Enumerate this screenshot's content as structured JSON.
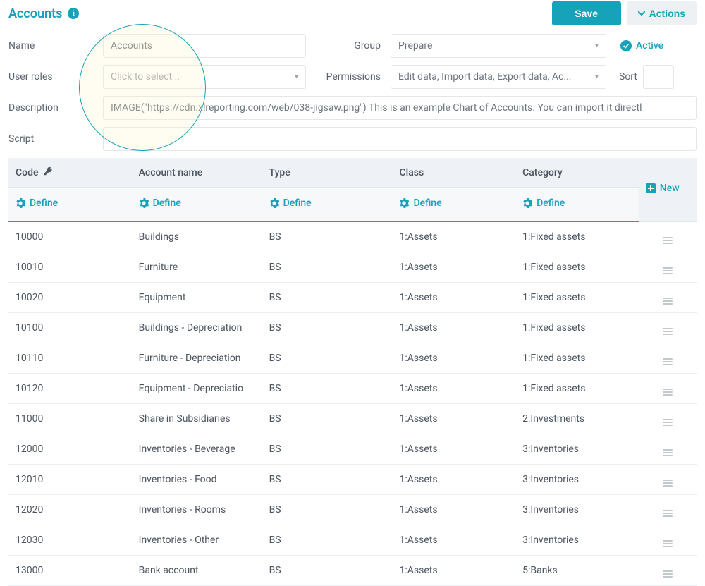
{
  "header": {
    "title": "Accounts",
    "save_label": "Save",
    "actions_label": "Actions"
  },
  "form": {
    "name_label": "Name",
    "name_value": "Accounts",
    "group_label": "Group",
    "group_value": "Prepare",
    "active_label": "Active",
    "userroles_label": "User roles",
    "userroles_placeholder": "Click to select ..",
    "permissions_label": "Permissions",
    "permissions_value": "Edit data, Import data, Export data, Ac...",
    "sort_label": "Sort",
    "sort_value": "",
    "description_label": "Description",
    "description_value": "IMAGE(\"https://cdn.xlreporting.com/web/038-jigsaw.png\") This is an example Chart of Accounts. You can import it directl",
    "script_label": "Script",
    "script_value": ""
  },
  "table": {
    "columns": {
      "code": "Code",
      "account_name": "Account name",
      "type": "Type",
      "class": "Class",
      "category": "Category"
    },
    "define_label": "Define",
    "new_label": "New",
    "rows": [
      {
        "code": "10000",
        "name": "Buildings",
        "type": "BS",
        "class": "1:Assets",
        "category": "1:Fixed assets"
      },
      {
        "code": "10010",
        "name": "Furniture",
        "type": "BS",
        "class": "1:Assets",
        "category": "1:Fixed assets"
      },
      {
        "code": "10020",
        "name": "Equipment",
        "type": "BS",
        "class": "1:Assets",
        "category": "1:Fixed assets"
      },
      {
        "code": "10100",
        "name": "Buildings - Depreciation",
        "type": "BS",
        "class": "1:Assets",
        "category": "1:Fixed assets"
      },
      {
        "code": "10110",
        "name": "Furniture - Depreciation",
        "type": "BS",
        "class": "1:Assets",
        "category": "1:Fixed assets"
      },
      {
        "code": "10120",
        "name": "Equipment - Depreciatio",
        "type": "BS",
        "class": "1:Assets",
        "category": "1:Fixed assets"
      },
      {
        "code": "11000",
        "name": "Share in Subsidiaries",
        "type": "BS",
        "class": "1:Assets",
        "category": "2:Investments"
      },
      {
        "code": "12000",
        "name": "Inventories - Beverage",
        "type": "BS",
        "class": "1:Assets",
        "category": "3:Inventories"
      },
      {
        "code": "12010",
        "name": "Inventories - Food",
        "type": "BS",
        "class": "1:Assets",
        "category": "3:Inventories"
      },
      {
        "code": "12020",
        "name": "Inventories - Rooms",
        "type": "BS",
        "class": "1:Assets",
        "category": "3:Inventories"
      },
      {
        "code": "12030",
        "name": "Inventories - Other",
        "type": "BS",
        "class": "1:Assets",
        "category": "3:Inventories"
      },
      {
        "code": "13000",
        "name": "Bank account",
        "type": "BS",
        "class": "1:Assets",
        "category": "5:Banks"
      }
    ]
  }
}
